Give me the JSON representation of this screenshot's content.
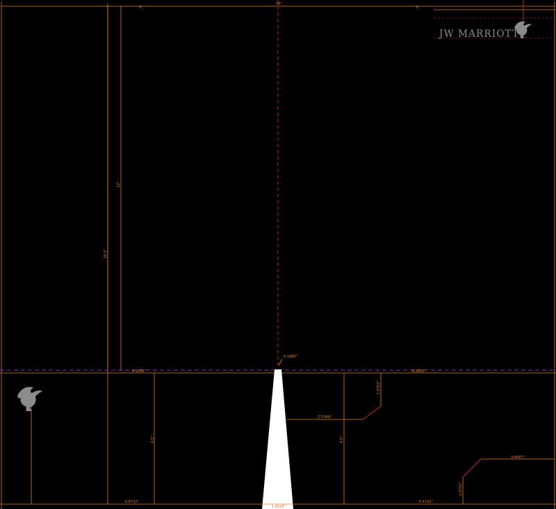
{
  "brand": {
    "name": "JW MARRIOTT",
    "logo_icon": "griffin-icon"
  },
  "dimensions": {
    "top_left_width": "9\"",
    "top_center_width": "18\"",
    "top_right_width": "9\"",
    "left_inner_height": "12\"",
    "left_outer_height": "16.5\"",
    "slot_width": "0.1888\"",
    "fold_left_width": "8.9056\"",
    "fold_right_width": "8.9056\"",
    "pocket_left_height": "4.5\"",
    "pocket_center_height": "4.5\"",
    "slit_upper_height": "1.0752\"",
    "slit_upper_width": "2.5349\"",
    "slit_lower_width": "3.4667\"",
    "slit_lower_height": "1.0752\"",
    "bottom_left_width": "8.4732\"",
    "bottom_center_width": "1.6518\"",
    "bottom_right_width": "8.4732\""
  },
  "colors": {
    "background": "#000000",
    "dimension": "#e0812f",
    "fold_line": "#7a3cc8",
    "cut_line": "#c0303a",
    "logo": "#8c8c8c",
    "slot": "#ffffff"
  }
}
